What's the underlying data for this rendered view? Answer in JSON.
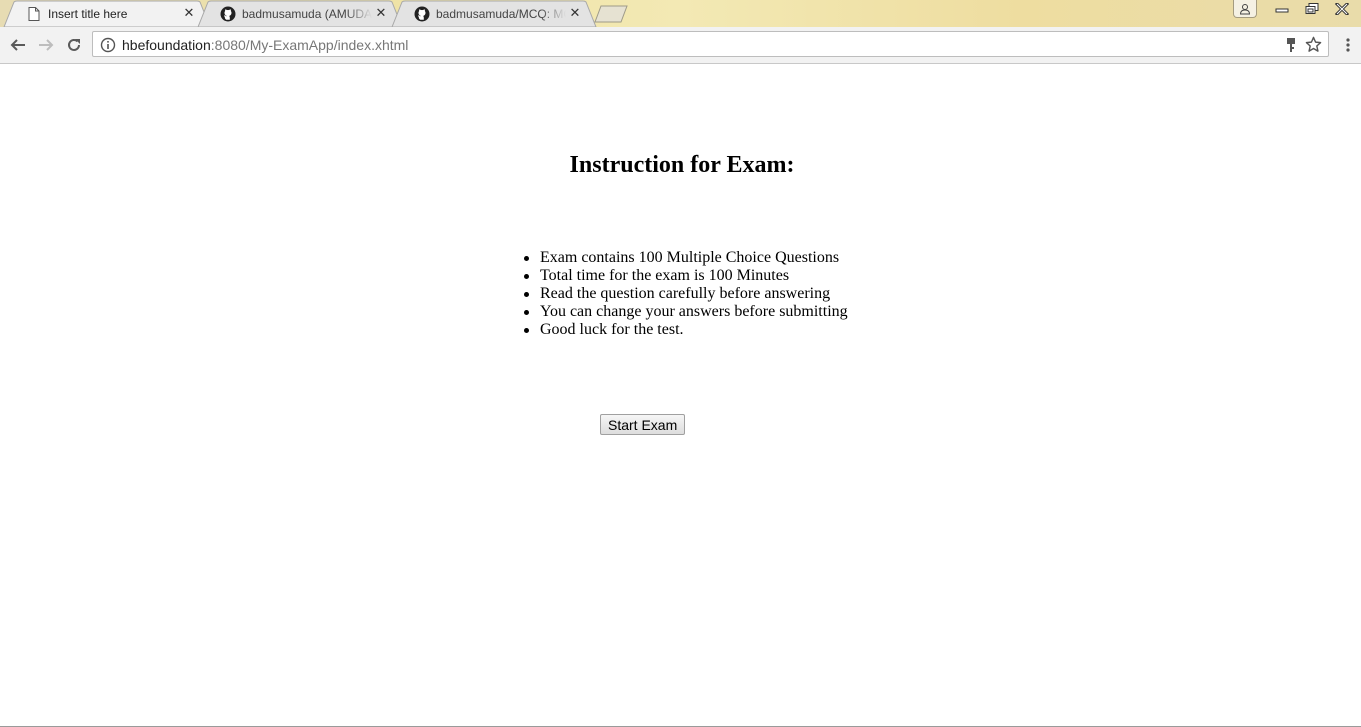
{
  "browser": {
    "tabs": [
      {
        "title": "Insert title here",
        "icon": "page-icon",
        "active": true
      },
      {
        "title": "badmusamuda (AMUDA",
        "icon": "github-icon",
        "active": false
      },
      {
        "title": "badmusamuda/MCQ: MC",
        "icon": "github-icon",
        "active": false
      }
    ],
    "url_host": "hbefoundation",
    "url_rest": ":8080/My-ExamApp/index.xhtml"
  },
  "page": {
    "title": "Instruction for Exam:",
    "instructions": [
      "Exam contains 100 Multiple Choice Questions",
      "Total time for the exam is 100 Minutes",
      "Read the question carefully before answering",
      "You can change your answers before submitting",
      "Good luck for the test."
    ],
    "start_button": "Start Exam"
  }
}
